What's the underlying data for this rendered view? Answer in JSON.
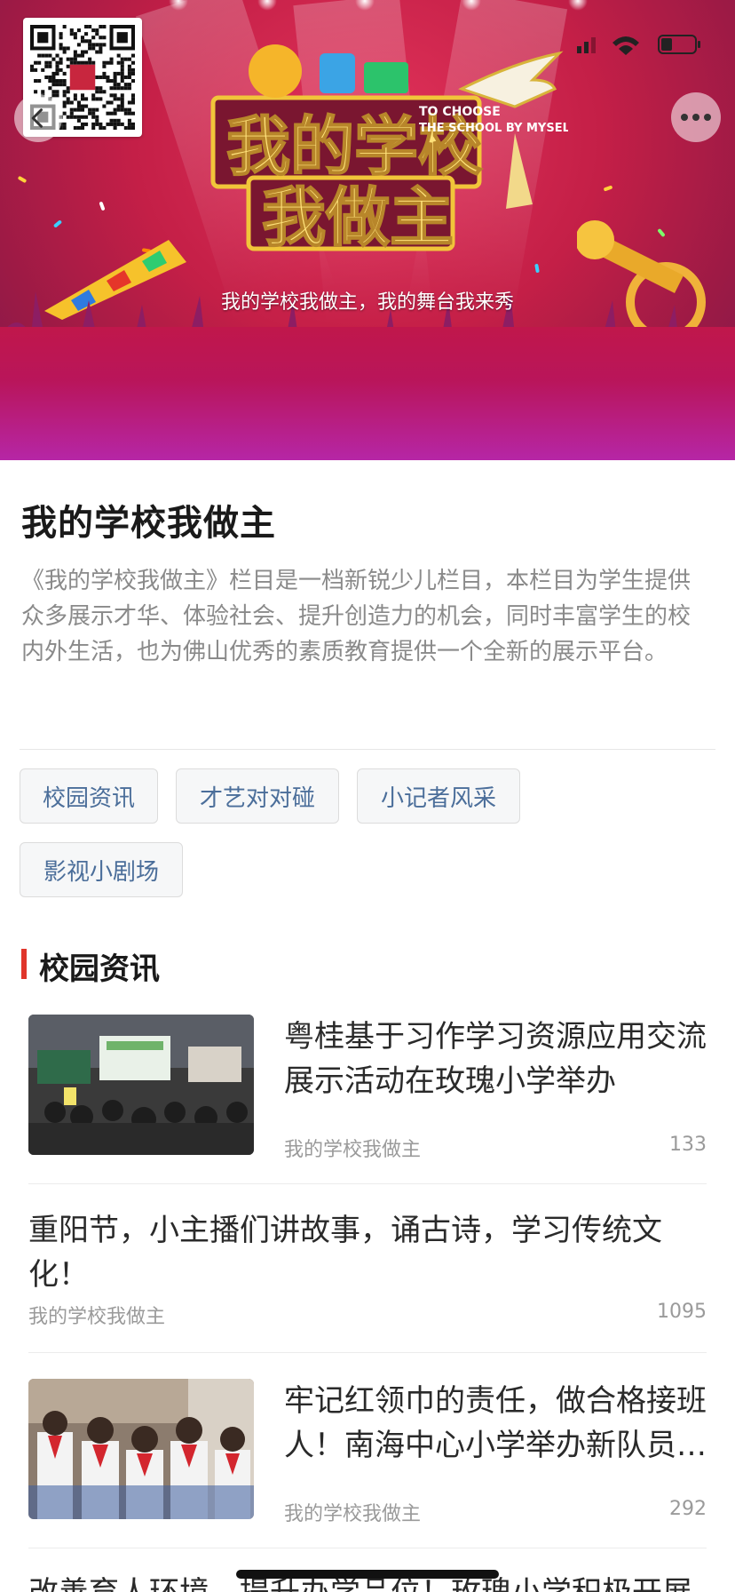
{
  "banner": {
    "logo_cn_line1": "我的学校",
    "logo_cn_line2": "我做主",
    "logo_en_line1": "TO CHOOSE",
    "logo_en_line2": "THE SCHOOL BY MYSELF",
    "slogan": "我的学校我做主，我的舞台我来秀"
  },
  "intro": {
    "title": "我的学校我做主",
    "description": "《我的学校我做主》栏目是一档新锐少儿栏目，本栏目为学生提供众多展示才华、体验社会、提升创造力的机会，同时丰富学生的校内外生活，也为佛山优秀的素质教育提供一个全新的展示平台。"
  },
  "tags": [
    "校园资讯",
    "才艺对对碰",
    "小记者风采",
    "影视小剧场"
  ],
  "section": {
    "title": "校园资讯"
  },
  "articles": [
    {
      "title": "粤桂基于习作学习资源应用交流展示活动在玫瑰小学举办",
      "source": "我的学校我做主",
      "count": "133",
      "thumb": "classroom-photo"
    },
    {
      "title": "重阳节，小主播们讲故事，诵古诗，学习传统文化！",
      "source": "我的学校我做主",
      "count": "1095"
    },
    {
      "title": "牢记红领巾的责任，做合格接班人！南海中心小学举办新队员入队仪式",
      "source": "我的学校我做主",
      "count": "292",
      "thumb": "young-pioneers-photo"
    },
    {
      "title": "改善育人环境，提升办学品位！玫瑰小学积极开展"
    }
  ],
  "colors": {
    "accent": "#e0352b",
    "tag_text": "#4b6e9a",
    "banner": "#c41f47"
  },
  "icons": {
    "back": "chevron-left-icon",
    "more": "more-dots-icon",
    "qr": "qr-code-icon"
  }
}
